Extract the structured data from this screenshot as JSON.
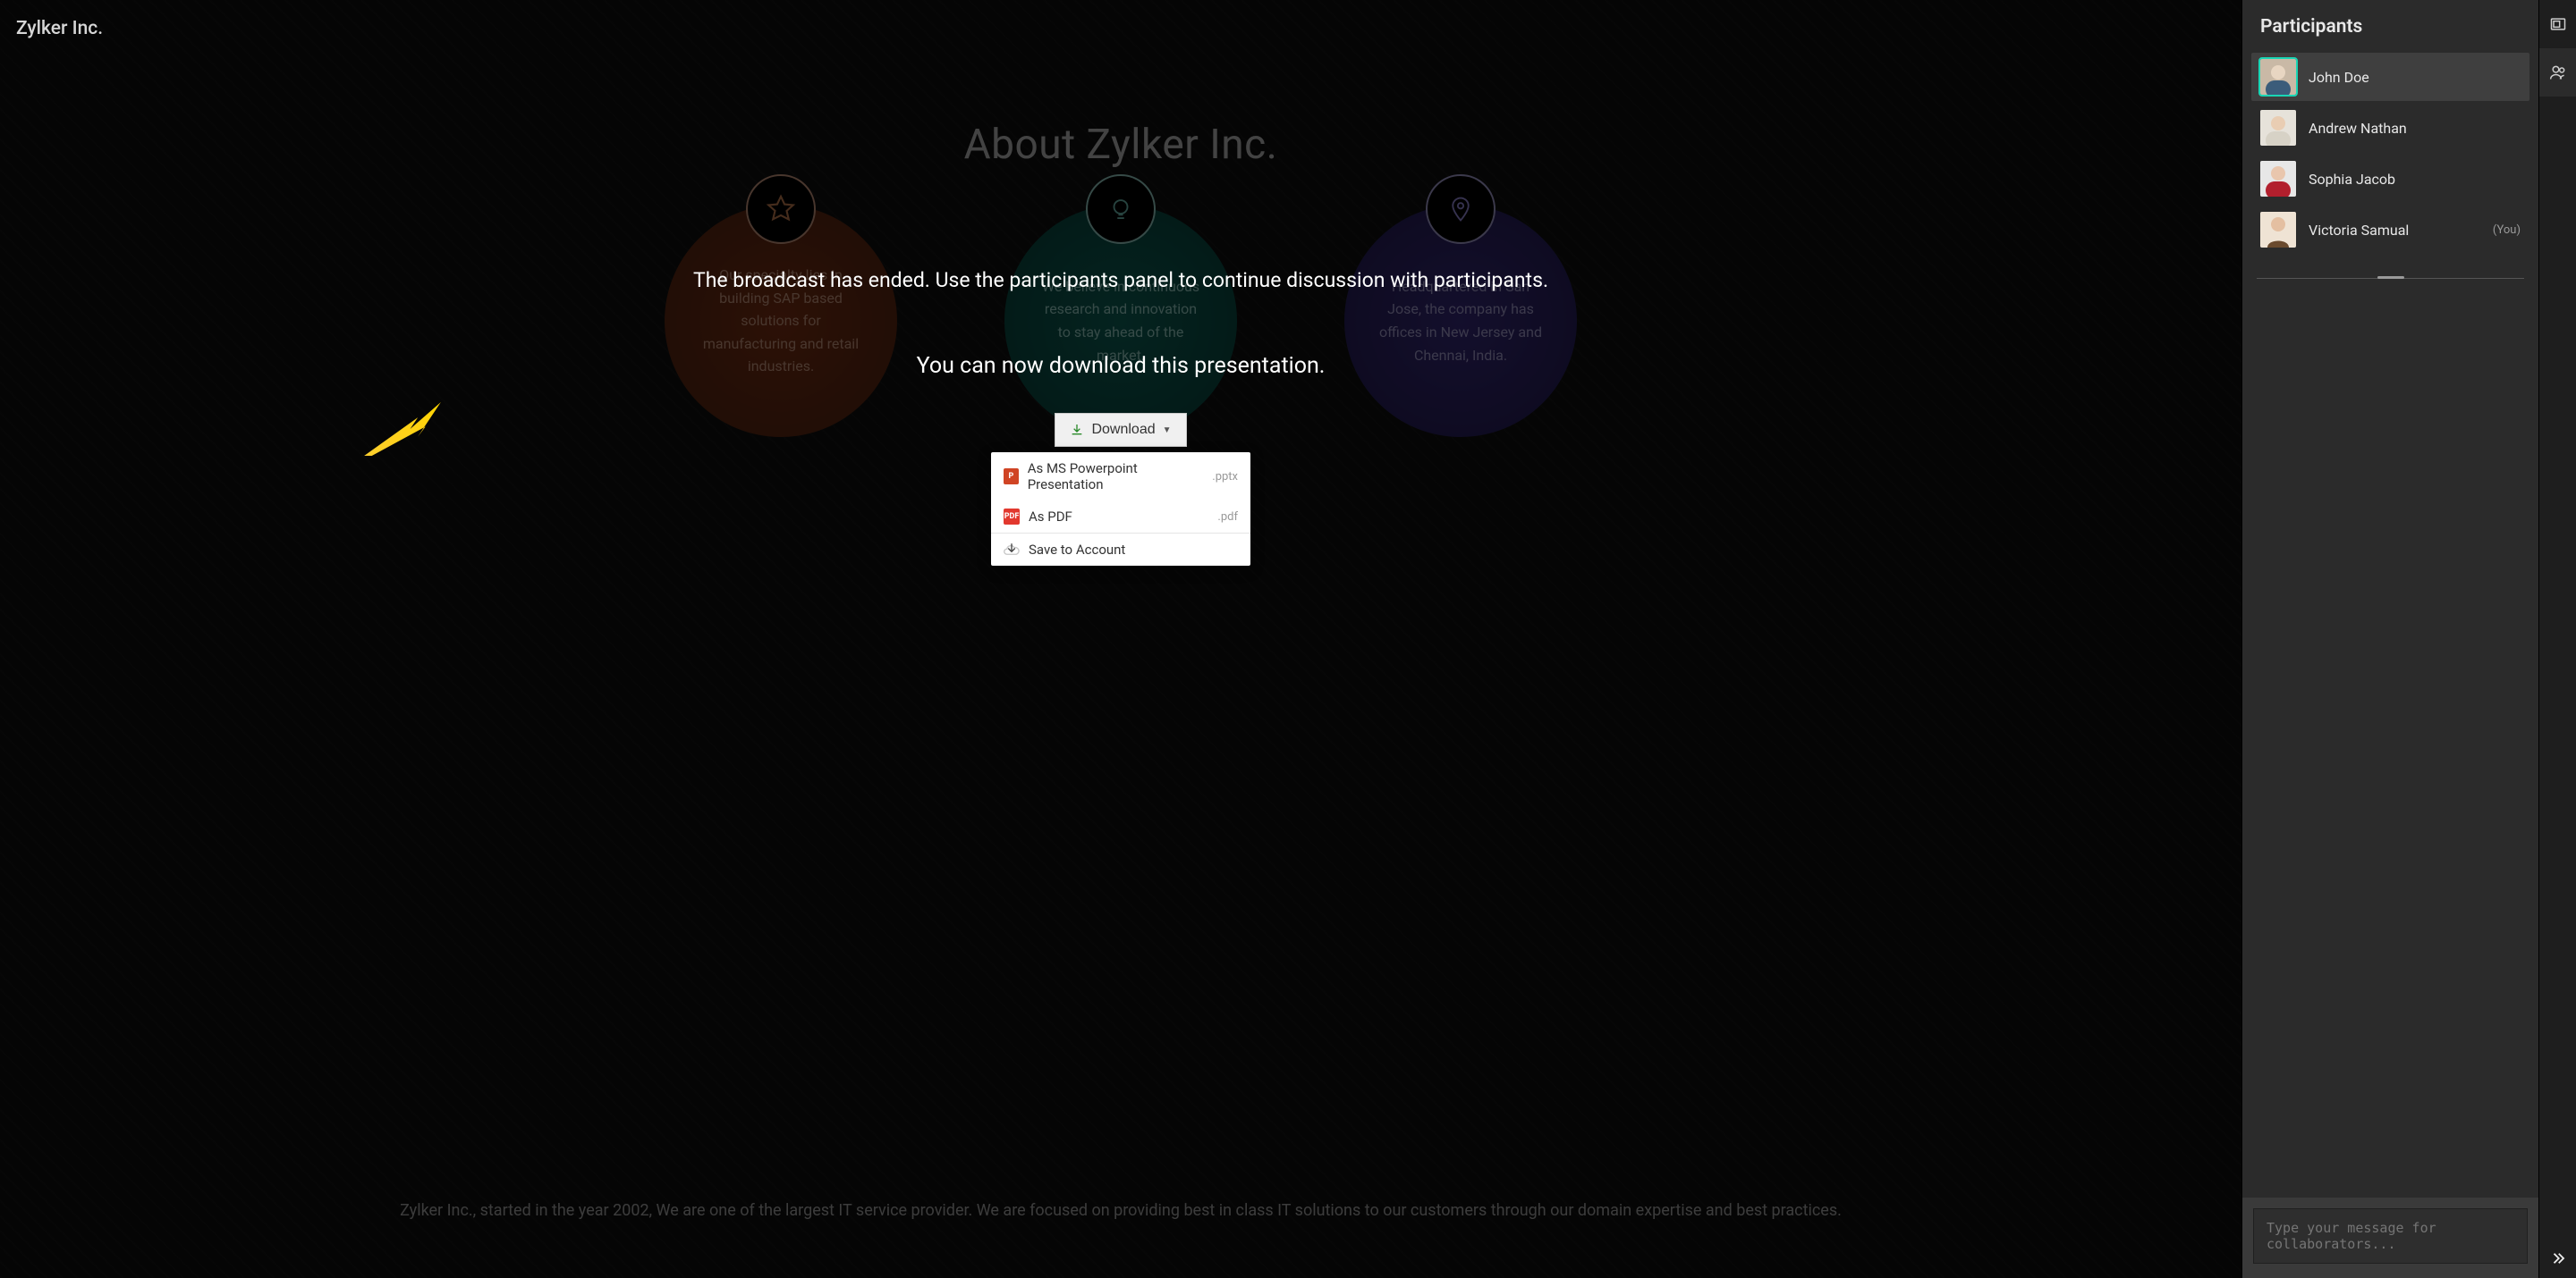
{
  "header": {
    "company": "Zylker Inc."
  },
  "slide": {
    "title": "About Zylker Inc.",
    "circle1": "Our specialty lies in building SAP based solutions for manufacturing and retail industries.",
    "circle2": "We believe in continuous research and innovation to stay ahead of the market.",
    "circle3": "Headquartered in San Jose, the company has offices in New Jersey and Chennai, India.",
    "footer": "Zylker Inc., started in the year 2002, We are one of the largest IT service provider. We are focused on providing best in class IT solutions to our customers through our domain expertise and best practices."
  },
  "overlay": {
    "ended": "The broadcast has ended. Use the participants panel to continue discussion with participants.",
    "download_prompt": "You can now download this presentation.",
    "download_button": "Download"
  },
  "dropdown": {
    "pptx_label": "As MS Powerpoint Presentation",
    "pptx_ext": ".pptx",
    "pdf_label": "As PDF",
    "pdf_ext": ".pdf",
    "save_label": "Save to Account"
  },
  "sidebar": {
    "title": "Participants",
    "participants": [
      {
        "name": "John Doe",
        "you": ""
      },
      {
        "name": "Andrew Nathan",
        "you": ""
      },
      {
        "name": "Sophia Jacob",
        "you": ""
      },
      {
        "name": "Victoria Samual",
        "you": "(You)"
      }
    ],
    "chat_placeholder": "Type your message for collaborators..."
  }
}
